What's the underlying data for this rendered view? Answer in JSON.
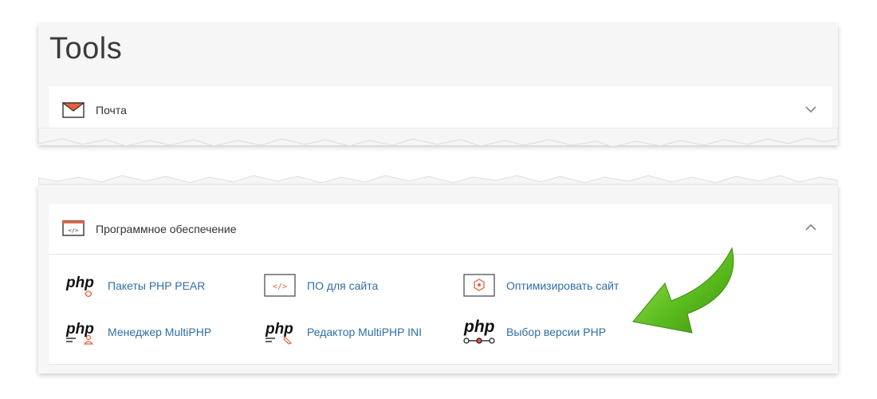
{
  "page": {
    "title": "Tools"
  },
  "sections": {
    "mail": {
      "label": "Почта",
      "icon": "envelope-icon",
      "state": "collapsed"
    },
    "software": {
      "label": "Программное обеспечение",
      "icon": "code-window-icon",
      "state": "expanded",
      "items": [
        {
          "label": "Пакеты PHP PEAR",
          "icon": "php-pear-icon"
        },
        {
          "label": "ПО для сайта",
          "icon": "site-software-icon"
        },
        {
          "label": "Оптимизировать сайт",
          "icon": "optimize-site-icon"
        },
        {
          "label": "Менеджер MultiPHP",
          "icon": "php-manager-icon"
        },
        {
          "label": "Редактор MultiPHP INI",
          "icon": "php-ini-editor-icon"
        },
        {
          "label": "Выбор версии PHP",
          "icon": "php-version-selector-icon"
        }
      ]
    }
  },
  "colors": {
    "accent_orange": "#e8613a",
    "link_blue": "#2f6ea7",
    "arrow_green": "#5bbd1e",
    "panel_bg": "#f6f6f6"
  }
}
